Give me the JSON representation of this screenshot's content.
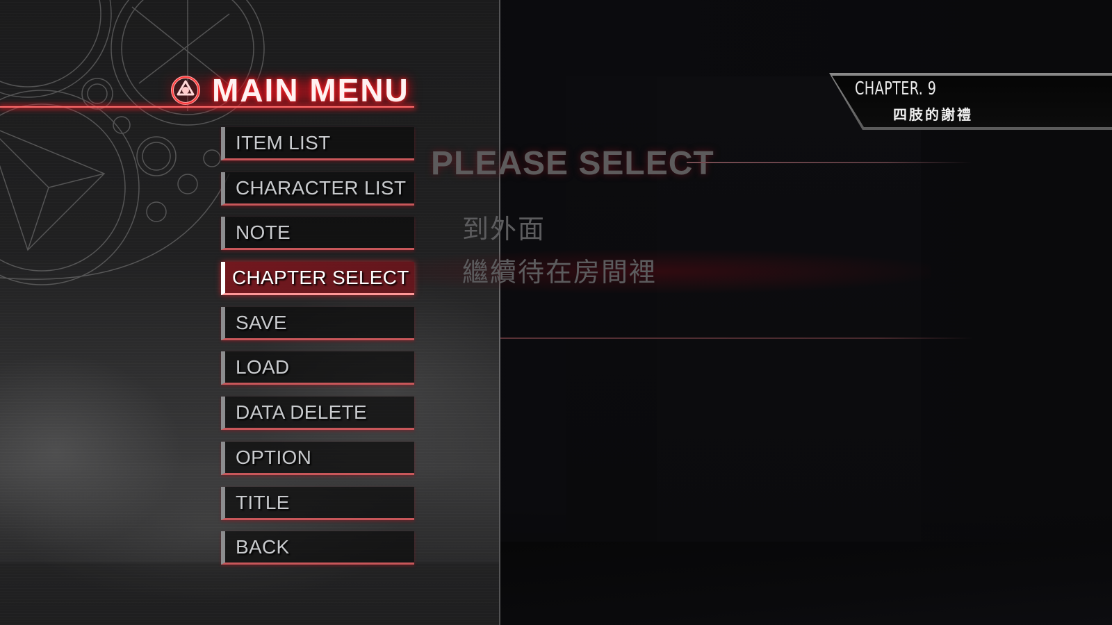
{
  "header": {
    "title": "MAIN MENU",
    "icon": "sigil-emblem-icon"
  },
  "menu": {
    "items": [
      {
        "label": "ITEM LIST",
        "selected": false
      },
      {
        "label": "CHARACTER LIST",
        "selected": false
      },
      {
        "label": "NOTE",
        "selected": false
      },
      {
        "label": "CHAPTER SELECT",
        "selected": true
      },
      {
        "label": "SAVE",
        "selected": false
      },
      {
        "label": "LOAD",
        "selected": false
      },
      {
        "label": "DATA DELETE",
        "selected": false
      },
      {
        "label": "OPTION",
        "selected": false
      },
      {
        "label": "TITLE",
        "selected": false
      },
      {
        "label": "BACK",
        "selected": false
      }
    ]
  },
  "chapter": {
    "number": "CHAPTER. 9",
    "name": "四肢的謝禮"
  },
  "prompt": {
    "title": "PLEASE SELECT",
    "options": [
      {
        "label": "到外面",
        "highlighted": false
      },
      {
        "label": "繼續待在房間裡",
        "highlighted": true
      }
    ]
  },
  "colors": {
    "accent_red": "#e0222e",
    "header_text": "#fff2f2",
    "menu_text": "#c9cbce",
    "menu_underline": "#c8575a",
    "prompt_text": "#5c5c5e"
  }
}
